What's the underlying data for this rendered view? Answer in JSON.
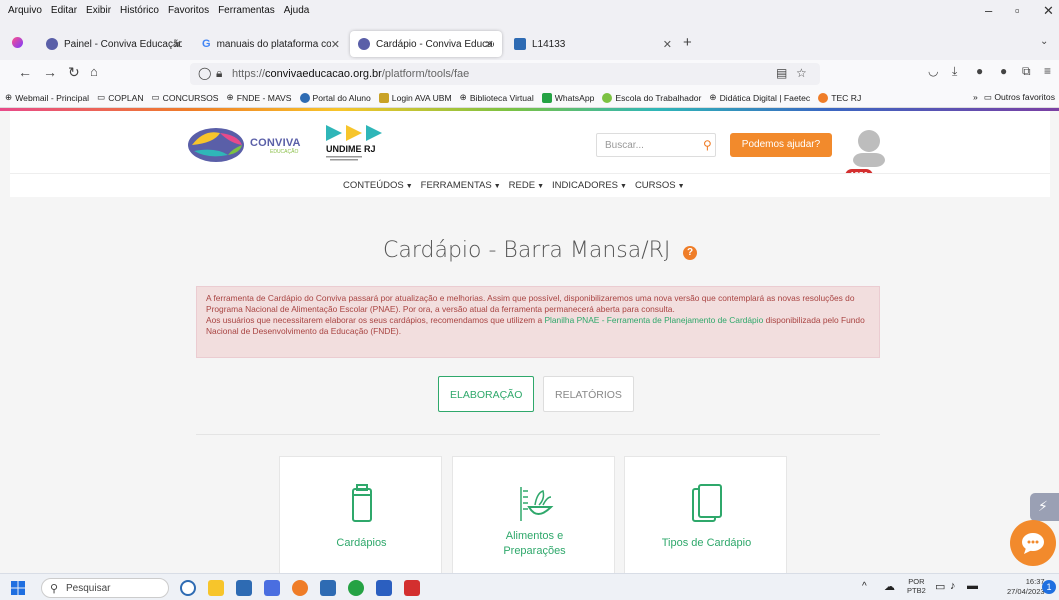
{
  "menu": {
    "items": [
      "Arquivo",
      "Editar",
      "Exibir",
      "Histórico",
      "Favoritos",
      "Ferramentas",
      "Ajuda"
    ]
  },
  "tabs": [
    {
      "label": "Painel - Conviva Educação",
      "active": false,
      "color": "#5a5fa8"
    },
    {
      "label": "manuais do plataforma conviva",
      "active": false,
      "color": "#4285f4"
    },
    {
      "label": "Cardápio - Conviva Educação",
      "active": true,
      "color": "#5a5fa8"
    },
    {
      "label": "L14133",
      "active": false,
      "color": "#2e6bb3"
    }
  ],
  "url": {
    "prefix": "https://",
    "host": "convivaeducacao.org.br",
    "path": "/platform/tools/fae"
  },
  "bookmarks": [
    {
      "label": "Webmail - Principal",
      "icon": "globe-icon"
    },
    {
      "label": "COPLAN",
      "icon": "folder-icon"
    },
    {
      "label": "CONCURSOS",
      "icon": "folder-icon"
    },
    {
      "label": "FNDE - MAVS",
      "icon": "globe-icon"
    },
    {
      "label": "Portal do Aluno",
      "icon": "portal-icon"
    },
    {
      "label": "Login AVA UBM",
      "icon": "ava-icon"
    },
    {
      "label": "Biblioteca Virtual",
      "icon": "globe-icon"
    },
    {
      "label": "WhatsApp",
      "icon": "whatsapp-icon"
    },
    {
      "label": "Escola do Trabalhador",
      "icon": "escola-icon"
    },
    {
      "label": "Didática Digital | Faetec",
      "icon": "globe-icon"
    },
    {
      "label": "TEC RJ",
      "icon": "tec-icon"
    }
  ],
  "bookmarks_more": "Outros favoritos",
  "site": {
    "brand": "CONVIVA",
    "brand_sub": "EDUCAÇÃO",
    "undime": "UNDIME RJ",
    "search_placeholder": "Buscar...",
    "help_button": "Podemos ajudar?",
    "notifications": "1856",
    "nav": [
      "CONTEÚDOS",
      "FERRAMENTAS",
      "REDE",
      "INDICADORES",
      "CURSOS"
    ],
    "title": "Cardápio - Barra Mansa/RJ",
    "notice": {
      "p1": "A ferramenta de Cardápio do Conviva passará por atualização e melhorias. Assim que possível, disponibilizaremos uma nova versão que contemplará as novas resoluções do Programa Nacional de Alimentação Escolar (PNAE). Por ora, a versão atual da ferramenta permanecerá aberta para consulta.",
      "p2_start": "Aos usuários que necessitarem elaborar os seus cardápios, recomendamos que utilizem a ",
      "p2_link": "Planilha PNAE - Ferramenta de Planejamento de Cardápio",
      "p2_end": " disponibilizada pelo Fundo Nacional de Desenvolvimento da Educação (FNDE)."
    },
    "tabs": {
      "elaboracao": "ELABORAÇÃO",
      "relatorios": "RELATÓRIOS"
    },
    "cards": [
      {
        "label": "Cardápios"
      },
      {
        "label": "Alimentos e Preparações"
      },
      {
        "label": "Tipos de Cardápio"
      }
    ]
  },
  "taskbar": {
    "search": "Pesquisar",
    "lang1": "POR",
    "lang2": "PTB2",
    "time": "16:37",
    "date": "27/04/2023"
  },
  "colors": {
    "accent_green": "#2fa86b",
    "accent_orange": "#f28a2c",
    "notice_bg": "#f2dede",
    "notice_text": "#a94442"
  }
}
